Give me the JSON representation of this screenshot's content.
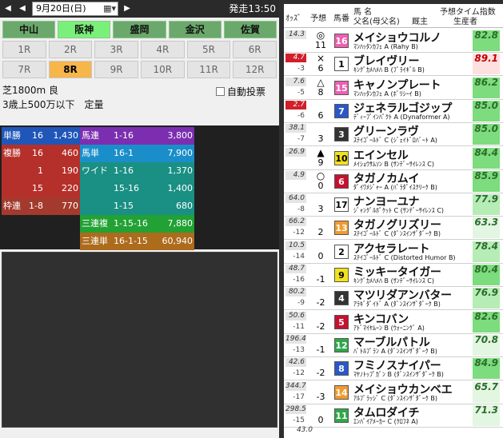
{
  "topbar": {
    "date": "9月20日(日)",
    "post_time": "発走13:50"
  },
  "venues": [
    {
      "label": "中山",
      "selected": false
    },
    {
      "label": "阪神",
      "selected": true
    },
    {
      "label": "盛岡",
      "selected": false
    },
    {
      "label": "金沢",
      "selected": false
    },
    {
      "label": "佐賀",
      "selected": false
    }
  ],
  "races": [
    "1R",
    "2R",
    "3R",
    "4R",
    "5R",
    "6R",
    "7R",
    "8R",
    "9R",
    "10R",
    "11R",
    "12R"
  ],
  "selected_race": "8R",
  "condition": {
    "line1": "芝1800m 良",
    "line2": "3歳上500万以下　定量"
  },
  "auto_vote_label": "自動投票",
  "odds_colors": {
    "win_bg": "#1f56b8",
    "place_bg": "#b5302a",
    "wakuren_bg": "#a33a2d",
    "umaren_bg": "#7b2fb0",
    "umatan_bg": "#1a8ec9",
    "wide_bg": "#1a8f84",
    "trio_bg": "#22a134",
    "trifecta_bg": "#ad6b1c"
  },
  "odds": {
    "win": {
      "label": "単勝",
      "num": "16",
      "val": "1,430"
    },
    "place": {
      "label": "複勝",
      "rows": [
        {
          "num": "16",
          "val": "460"
        },
        {
          "num": "1",
          "val": "190"
        },
        {
          "num": "15",
          "val": "220"
        }
      ]
    },
    "wakuren": {
      "label": "枠連",
      "num": "1-8",
      "val": "770"
    },
    "umaren": {
      "label": "馬連",
      "num": "1-16",
      "val": "3,800"
    },
    "umatan": {
      "label": "馬単",
      "num": "16-1",
      "val": "7,900"
    },
    "wide": {
      "label": "ワイド",
      "rows": [
        {
          "num": "1-16",
          "val": "1,370"
        },
        {
          "num": "15-16",
          "val": "1,400"
        },
        {
          "num": "1-15",
          "val": "680"
        }
      ]
    },
    "trio": {
      "label": "三連複",
      "num": "1-15-16",
      "val": "7,880"
    },
    "trifecta": {
      "label": "三連単",
      "num": "16-1-15",
      "val": "60,940"
    }
  },
  "list_header": {
    "odds": "ｵｯｽﾞ",
    "pred": "予想",
    "num": "馬番",
    "name": "馬 名",
    "dam": "父名(母父名)",
    "owner": "厩主",
    "idx": "予想タイム指数",
    "breeder": "生産者"
  },
  "waku_colors": {
    "1": {
      "bg": "#ffffff",
      "fg": "#000000"
    },
    "2": {
      "bg": "#ffffff",
      "fg": "#000000"
    },
    "3": {
      "bg": "#333333",
      "fg": "#ffffff"
    },
    "4": {
      "bg": "#333333",
      "fg": "#ffffff"
    },
    "5": {
      "bg": "#c8102e",
      "fg": "#ffffff"
    },
    "6": {
      "bg": "#c8102e",
      "fg": "#ffffff"
    },
    "7": {
      "bg": "#2a58c8",
      "fg": "#ffffff"
    },
    "8": {
      "bg": "#2a58c8",
      "fg": "#ffffff"
    },
    "9": {
      "bg": "#f2e21a",
      "fg": "#000000"
    },
    "10": {
      "bg": "#f2e21a",
      "fg": "#000000"
    },
    "11": {
      "bg": "#2ea84a",
      "fg": "#ffffff"
    },
    "12": {
      "bg": "#2ea84a",
      "fg": "#ffffff"
    },
    "13": {
      "bg": "#f29a2e",
      "fg": "#ffffff"
    },
    "14": {
      "bg": "#f29a2e",
      "fg": "#ffffff"
    },
    "15": {
      "bg": "#ee5fb2",
      "fg": "#ffffff"
    },
    "16": {
      "bg": "#ee5fb2",
      "fg": "#ffffff"
    }
  },
  "horses": [
    {
      "odds": "14.3",
      "pop": "",
      "mark": "◎",
      "rank": "11",
      "num": "16",
      "name": "メイショウコルノ",
      "sire": "ﾏﾝﾊｯﾀﾝｶﾌｪ A (Rahy B)",
      "idx": "82.8",
      "odds_hl": false,
      "idx_red": false
    },
    {
      "odds": "4.7",
      "pop": "-3",
      "mark": "×",
      "rank": "6",
      "num": "1",
      "name": "ブレイヴリー",
      "sire": "ｷﾝｸﾞｶﾒﾊﾒﾊ B (ﾌﾞﾗｲｷﾞﾙ B)",
      "idx": "89.1",
      "odds_hl": true,
      "idx_red": true
    },
    {
      "odds": "7.6",
      "pop": "-5",
      "mark": "△",
      "rank": "8",
      "num": "15",
      "name": "キャノンプレート",
      "sire": "ﾏﾝﾊｯﾀﾝｶﾌｪ A (ﾎﾞﾘｼｰｲ B)",
      "idx": "86.2",
      "odds_hl": false,
      "idx_red": false
    },
    {
      "odds": "2.7",
      "pop": "-6",
      "mark": "",
      "rank": "6",
      "num": "7",
      "name": "ジェネラルゴジップ",
      "sire": "ﾃﾞｨｰﾌﾟｲﾝﾊﾟｸﾄ A (Dynaformer A)",
      "idx": "85.0",
      "odds_hl": true,
      "idx_red": false
    },
    {
      "odds": "38.1",
      "pop": "-7",
      "mark": "",
      "rank": "3",
      "num": "3",
      "name": "グリーンラヴ",
      "sire": "ｽﾃｲｺﾞｰﾙﾄﾞ C (ｼﾞｪｲﾄﾞﾛﾊﾞｰﾄ A)",
      "idx": "85.0",
      "odds_hl": false,
      "idx_red": false
    },
    {
      "odds": "26.9",
      "pop": "",
      "mark": "▲",
      "rank": "9",
      "num": "10",
      "name": "エインセル",
      "sire": "ﾒｲｼｮｳｻﾑｿﾝ B (ｻﾝﾃﾞｰｻｲﾚﾝｽ C)",
      "idx": "84.4",
      "odds_hl": false,
      "idx_red": false
    },
    {
      "odds": "4.9",
      "pop": "",
      "mark": "○",
      "rank": "0",
      "num": "6",
      "name": "タガノカムイ",
      "sire": "ﾀﾞｲﾜﾒｼﾞｬｰ A (ﾊﾟﾗﾀﾞｲｽｸﾘｰｸ B)",
      "idx": "85.9",
      "odds_hl": false,
      "idx_red": false
    },
    {
      "odds": "64.0",
      "pop": "-8",
      "mark": "",
      "rank": "3",
      "num": "17",
      "name": "ナンヨーユナ",
      "sire": "ｼﾞｬﾝｸﾞﾙﾎﾟｹｯﾄ C (ｻﾝﾃﾞｰｻｲﾚﾝｽ C)",
      "idx": "77.9",
      "odds_hl": false,
      "idx_red": false
    },
    {
      "odds": "66.2",
      "pop": "-12",
      "mark": "",
      "rank": "2",
      "num": "13",
      "name": "タガノグリズリー",
      "sire": "ｽﾃｲｺﾞｰﾙﾄﾞ C (ﾀﾞﾝｽｲﾝｻﾞﾀﾞｰｸ B)",
      "idx": "63.3",
      "odds_hl": false,
      "idx_red": false
    },
    {
      "odds": "10.5",
      "pop": "-14",
      "mark": "",
      "rank": "0",
      "num": "2",
      "name": "アクセラレート",
      "sire": "ｽﾃｲｺﾞｰﾙﾄﾞ C (Distorted Humor B)",
      "idx": "78.4",
      "odds_hl": false,
      "idx_red": false
    },
    {
      "odds": "48.7",
      "pop": "-16",
      "mark": "",
      "rank": "-1",
      "num": "9",
      "name": "ミッキータイガー",
      "sire": "ｷﾝｸﾞｶﾒﾊﾒﾊ B (ｻﾝﾃﾞｰｻｲﾚﾝｽ C)",
      "idx": "80.4",
      "odds_hl": false,
      "idx_red": false
    },
    {
      "odds": "80.2",
      "pop": "-9",
      "mark": "",
      "rank": "-2",
      "num": "4",
      "name": "マツリダアンバター",
      "sire": "ｱﾗｷﾞﾀﾞｲﾄﾞ A (ﾀﾞﾝｽｲﾝｻﾞﾀﾞｰｸ B)",
      "idx": "76.9",
      "odds_hl": false,
      "idx_red": false
    },
    {
      "odds": "50.6",
      "pop": "-11",
      "mark": "",
      "rank": "-2",
      "num": "5",
      "name": "キンコバン",
      "sire": "ｱﾄﾞﾏｲﾔﾑｰﾝ B (ｳｫｰﾆﾝｸﾞ A)",
      "idx": "82.6",
      "odds_hl": false,
      "idx_red": false
    },
    {
      "odds": "196.4",
      "pop": "-13",
      "mark": "",
      "rank": "-1",
      "num": "12",
      "name": "マーブルパトル",
      "sire": "ﾊﾞﾄﾙﾌﾟﾗﾝ A (ﾀﾞﾝｽｲﾝｻﾞﾀﾞｰｸ B)",
      "idx": "70.8",
      "odds_hl": false,
      "idx_red": false
    },
    {
      "odds": "42.6",
      "pop": "-12",
      "mark": "",
      "rank": "-2",
      "num": "8",
      "name": "フミノスナイパー",
      "sire": "ﾏﾔﾉﾄｯﾌﾟｶﾞﾝ B (ﾀﾞﾝｽｲﾝｻﾞﾀﾞｰｸ B)",
      "idx": "84.9",
      "odds_hl": false,
      "idx_red": false
    },
    {
      "odds": "344.7",
      "pop": "-17",
      "mark": "",
      "rank": "-3",
      "num": "14",
      "name": "メイショウカンベエ",
      "sire": "ｱﾙﾌﾞﾗｯｼﾞ C (ﾀﾞﾝｽｲﾝｻﾞﾀﾞｰｸ B)",
      "idx": "65.7",
      "odds_hl": false,
      "idx_red": false
    },
    {
      "odds": "298.5",
      "pop": "-15",
      "mark": "",
      "rank": "0",
      "num": "11",
      "name": "タムロダイチ",
      "sire": "ｴﾝﾊﾟｲｱﾒｰｶｰ C (ｸﾛﾌﾈ A)",
      "idx": "71.3",
      "odds_hl": false,
      "idx_red": false
    }
  ],
  "footer_odds": "43.0"
}
